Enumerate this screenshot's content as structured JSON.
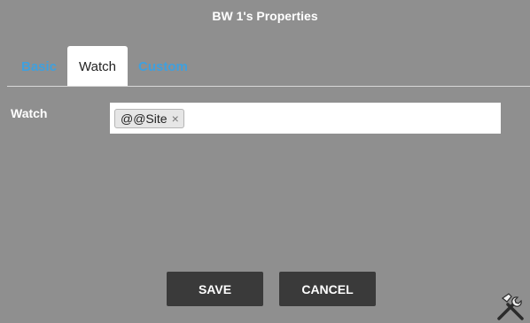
{
  "dialog": {
    "title": "BW 1's Properties"
  },
  "tabs": [
    {
      "label": "Basic",
      "active": false
    },
    {
      "label": "Watch",
      "active": true
    },
    {
      "label": "Custom",
      "active": false
    }
  ],
  "watch": {
    "label": "Watch",
    "tags": [
      {
        "text": "@@Site",
        "remove_symbol": "×"
      }
    ]
  },
  "buttons": {
    "save": "SAVE",
    "cancel": "CANCEL"
  },
  "icons": {
    "tools": "hammer-wrench-icon"
  },
  "colors": {
    "dialog_bg": "#8f8f8f",
    "tab_link": "#3fa0de",
    "button_bg": "#3a3a3a"
  }
}
